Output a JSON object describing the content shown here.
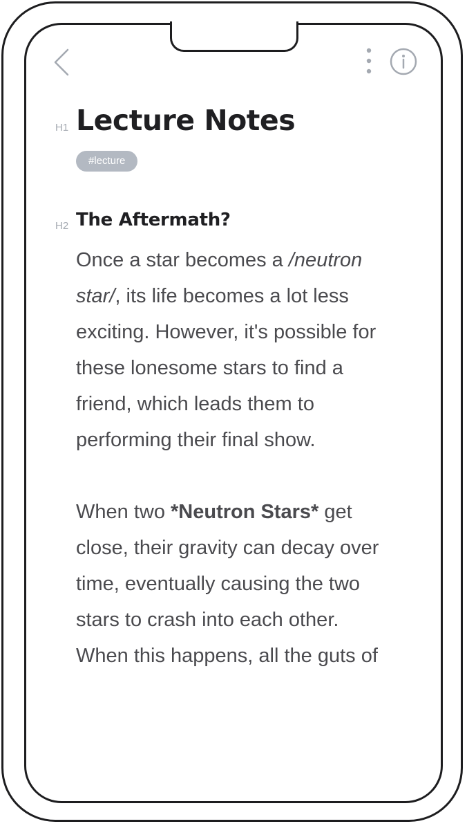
{
  "toolbar": {
    "back_icon": "chevron-left-icon",
    "more_icon": "more-vertical-icon",
    "info_icon": "info-icon"
  },
  "note": {
    "h1_marker": "H1",
    "title": "Lecture Notes",
    "tag": "#lecture",
    "h2_marker": "H2",
    "subheading": "The Aftermath?",
    "paragraph1": {
      "l1_a": "Once a star becomes a ",
      "l1_em": "/neutron",
      "l2_em": "star/",
      "l2_b": ", its life becomes a lot less",
      "l3": "exciting. However, it's possible for",
      "l4": "these lonesome stars to find a",
      "l5": "friend, which leads them to",
      "l6": "performing their final show."
    },
    "paragraph2": {
      "l1_a": "When two ",
      "l1_strong": "*Neutron Stars*",
      "l1_b": " get",
      "l2": "close, their gravity can decay over",
      "l3": "time, eventually causing the two",
      "l4": "stars to crash into each other.",
      "l5": "When this happens, all the guts of"
    }
  },
  "colors": {
    "frame": "#1d1d1f",
    "icon": "#a4a9b1",
    "tag_bg": "#b3b9c2",
    "heading": "#1f1f22",
    "body_text": "#4a4a4e"
  }
}
